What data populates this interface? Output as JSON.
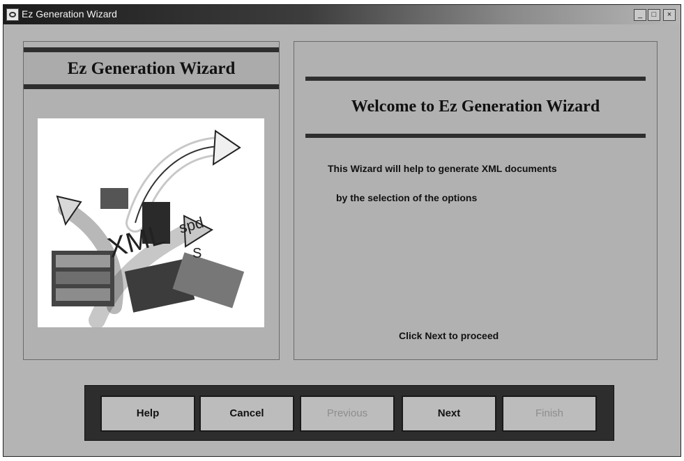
{
  "window": {
    "title": "Ez Generation Wizard",
    "controls": {
      "minimize": "_",
      "maximize": "□",
      "close": "×"
    }
  },
  "left_panel": {
    "header": "Ez Generation Wizard",
    "art_labels": {
      "xml": "XML",
      "spd": "spd",
      "s": "S"
    }
  },
  "right_panel": {
    "title": "Welcome to Ez Generation Wizard",
    "description_line1": "This Wizard will help to generate XML documents",
    "description_line2": "by the selection of the options",
    "proceed_hint": "Click Next to proceed"
  },
  "buttons": {
    "help": {
      "label": "Help",
      "enabled": true
    },
    "cancel": {
      "label": "Cancel",
      "enabled": true
    },
    "previous": {
      "label": "Previous",
      "enabled": false
    },
    "next": {
      "label": "Next",
      "enabled": true
    },
    "finish": {
      "label": "Finish",
      "enabled": false
    }
  }
}
